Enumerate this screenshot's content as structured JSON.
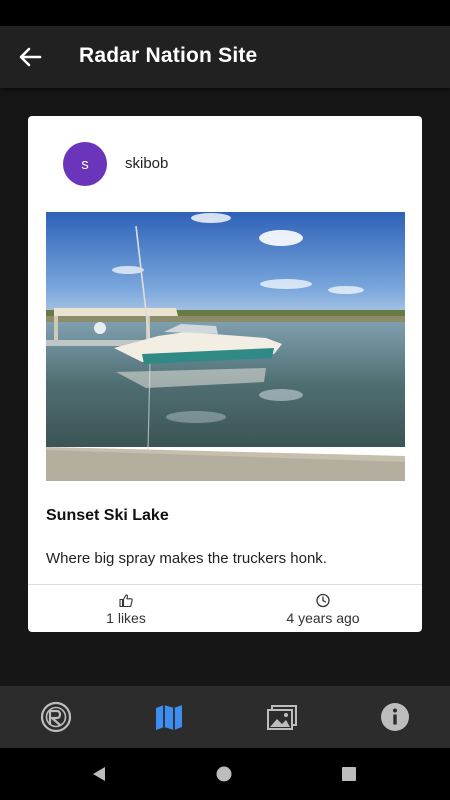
{
  "app": {
    "title": "Radar Nation Site"
  },
  "post": {
    "avatar_initial": "s",
    "username": "skibob",
    "title": "Sunset Ski Lake",
    "description": "Where big spray makes the truckers honk.",
    "likes": "1 likes",
    "age": "4 years ago"
  },
  "colors": {
    "avatar": "#6a35bb",
    "active_nav": "#3d8ef0",
    "appbar": "#212121"
  },
  "bottom_nav": {
    "items": [
      {
        "icon": "radar-logo-icon",
        "active": false
      },
      {
        "icon": "map-icon",
        "active": true
      },
      {
        "icon": "gallery-icon",
        "active": false
      },
      {
        "icon": "info-icon",
        "active": false
      }
    ]
  }
}
